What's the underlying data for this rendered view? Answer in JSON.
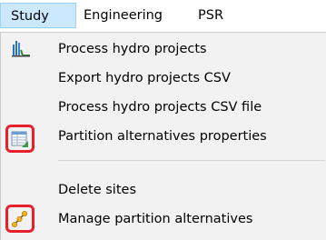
{
  "menubar": {
    "items": [
      {
        "label": "Study"
      },
      {
        "label": "Engineering"
      },
      {
        "label": "PSR"
      }
    ]
  },
  "menu": {
    "items": [
      {
        "label": "Process hydro projects",
        "icon": "hydro-chart-icon"
      },
      {
        "label": "Export hydro projects CSV",
        "icon": ""
      },
      {
        "label": "Process hydro projects CSV file",
        "icon": ""
      },
      {
        "label": "Partition alternatives properties",
        "icon": "table-properties-icon"
      },
      {
        "label": "Delete sites",
        "icon": ""
      },
      {
        "label": "Manage partition alternatives",
        "icon": "partition-link-icon"
      }
    ]
  },
  "colors": {
    "active_menu_bg": "#cce8ff",
    "active_menu_border": "#99d1ff",
    "dropdown_bg": "#f2f2f2",
    "highlight_border": "#e8202c"
  }
}
